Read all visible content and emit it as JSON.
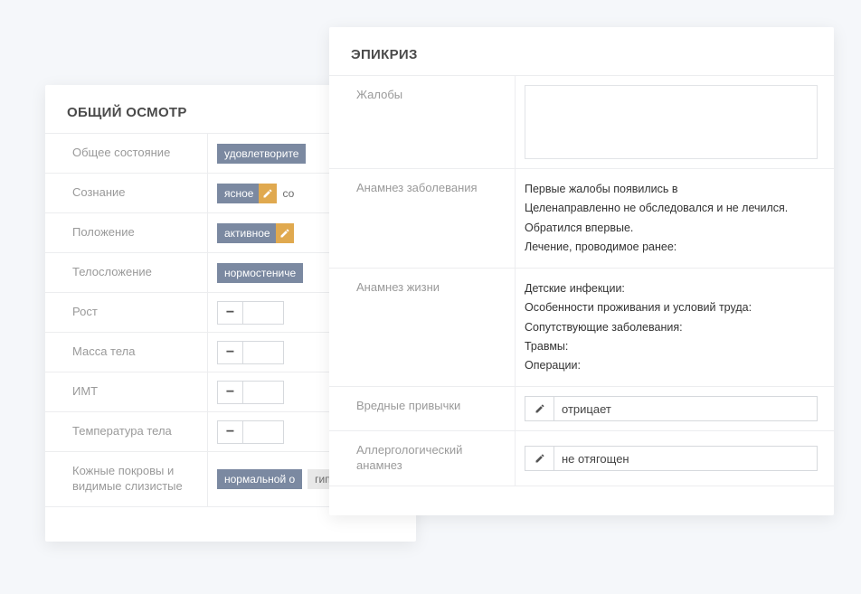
{
  "left_card": {
    "title": "ОБЩИЙ ОСМОТР",
    "rows": {
      "general": {
        "label": "Общее состояние",
        "tag": "удовлетворите"
      },
      "consciousness": {
        "label": "Сознание",
        "tag": "ясное",
        "trailing": "со"
      },
      "position": {
        "label": "Положение",
        "tag": "активное"
      },
      "body_type": {
        "label": "Телосложение",
        "tag": "нормостениче"
      },
      "height": {
        "label": "Рост"
      },
      "weight": {
        "label": "Масса тела"
      },
      "bmi": {
        "label": "ИМТ"
      },
      "temperature": {
        "label": "Температура тела"
      },
      "skin": {
        "label": "Кожные покровы и видимые слизистые",
        "tag": "нормальной о",
        "tag2": "гипергидроз"
      }
    }
  },
  "right_card": {
    "title": "ЭПИКРИЗ",
    "rows": {
      "complaints": {
        "label": "Жалобы"
      },
      "disease_history": {
        "label": "Анамнез заболевания",
        "line1": "Первые жалобы появились в",
        "line2": "Целенаправленно не обследовался и не лечился.",
        "line3": "Обратился впервые.",
        "line4": "Лечение, проводимое ранее:"
      },
      "life_history": {
        "label": "Анамнез жизни",
        "line1": "Детские инфекции:",
        "line2": "Особенности проживания и условий труда:",
        "line3": "Сопутствующие заболевания:",
        "line4": "Травмы:",
        "line5": "Операции:"
      },
      "bad_habits": {
        "label": "Вредные привычки",
        "value": "отрицает"
      },
      "allergies": {
        "label": "Аллергологический анамнез",
        "value": "не отягощен"
      }
    }
  }
}
